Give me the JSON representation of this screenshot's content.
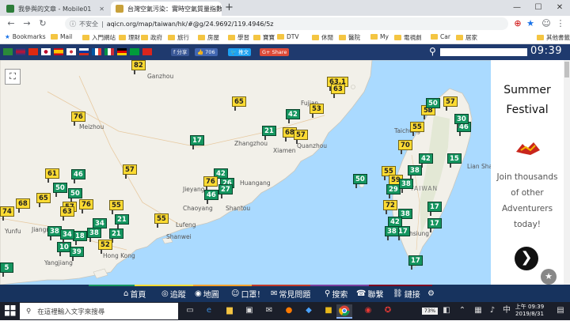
{
  "browser": {
    "tabs": [
      {
        "title": "我參與的文章 - Mobile01",
        "active": false
      },
      {
        "title": "台灣空氣污染：實時空氣質量指數地圖",
        "active": true
      }
    ],
    "new_tab": "+",
    "window_controls": {
      "minimize": "—",
      "maximize": "☐",
      "close": "✕"
    },
    "security_label": "不安全",
    "url": "aqicn.org/map/taiwan/hk/#@g/24.9692/119.4946/5z",
    "bookmarks": [
      {
        "label": "Bookmarks",
        "kind": "star"
      },
      {
        "label": "Mail",
        "kind": "folder"
      },
      {
        "label": "入門網站",
        "kind": "folder"
      },
      {
        "label": "理財",
        "kind": "folder"
      },
      {
        "label": "政府",
        "kind": "folder"
      },
      {
        "label": "旅行",
        "kind": "folder"
      },
      {
        "label": "房屋",
        "kind": "folder"
      },
      {
        "label": "學習",
        "kind": "folder"
      },
      {
        "label": "寶寶",
        "kind": "folder"
      },
      {
        "label": "DTV",
        "kind": "folder"
      },
      {
        "label": "休閒",
        "kind": "folder"
      },
      {
        "label": "醫院",
        "kind": "folder"
      },
      {
        "label": "My",
        "kind": "folder"
      },
      {
        "label": "電視劇",
        "kind": "folder"
      },
      {
        "label": "Car",
        "kind": "folder"
      },
      {
        "label": "居家",
        "kind": "folder"
      },
      {
        "label": "其他書籤",
        "kind": "folder"
      }
    ]
  },
  "page_header": {
    "share_fb": "分享",
    "like": "706",
    "tweet": "推文",
    "gplus": "Share",
    "clock": "09:39"
  },
  "map": {
    "places": [
      {
        "name": "Ganzhou"
      },
      {
        "name": "Meizhou"
      },
      {
        "name": "Zhangzhou"
      },
      {
        "name": "Xiamen"
      },
      {
        "name": "Quanzhou"
      },
      {
        "name": "Huangang"
      },
      {
        "name": "Jieyang"
      },
      {
        "name": "Chaoyang"
      },
      {
        "name": "Shantou"
      },
      {
        "name": "Lufeng"
      },
      {
        "name": "Shanwei"
      },
      {
        "name": "Yunfu"
      },
      {
        "name": "Jiangmen"
      },
      {
        "name": "Hong Kong"
      },
      {
        "name": "Yangjiang"
      },
      {
        "name": "Taichung"
      },
      {
        "name": "Lian Shan"
      },
      {
        "name": "TAIWAN"
      },
      {
        "name": "Kaohsiung"
      },
      {
        "name": "Fujian"
      }
    ],
    "markers": [
      {
        "v": "82",
        "c": "y"
      },
      {
        "v": "76",
        "c": "y"
      },
      {
        "v": "65",
        "c": "y"
      },
      {
        "v": "42",
        "c": "g"
      },
      {
        "v": "53",
        "c": "y"
      },
      {
        "v": "63.1",
        "c": "y"
      },
      {
        "v": "63",
        "c": "y"
      },
      {
        "v": "21",
        "c": "g"
      },
      {
        "v": "68",
        "c": "y"
      },
      {
        "v": "57",
        "c": "y"
      },
      {
        "v": "17",
        "c": "g"
      },
      {
        "v": "57",
        "c": "y"
      },
      {
        "v": "61",
        "c": "y"
      },
      {
        "v": "46",
        "c": "g"
      },
      {
        "v": "42",
        "c": "g"
      },
      {
        "v": "76",
        "c": "y"
      },
      {
        "v": "26",
        "c": "g"
      },
      {
        "v": "27",
        "c": "g"
      },
      {
        "v": "46",
        "c": "g"
      },
      {
        "v": "50",
        "c": "g"
      },
      {
        "v": "50",
        "c": "g"
      },
      {
        "v": "65",
        "c": "y"
      },
      {
        "v": "68",
        "c": "y"
      },
      {
        "v": "57",
        "c": "y"
      },
      {
        "v": "76",
        "c": "y"
      },
      {
        "v": "63",
        "c": "y"
      },
      {
        "v": "74",
        "c": "y"
      },
      {
        "v": "55",
        "c": "y"
      },
      {
        "v": "55",
        "c": "y"
      },
      {
        "v": "34",
        "c": "g"
      },
      {
        "v": "21",
        "c": "g"
      },
      {
        "v": "21",
        "c": "g"
      },
      {
        "v": "38",
        "c": "g"
      },
      {
        "v": "18",
        "c": "g"
      },
      {
        "v": "52",
        "c": "y"
      },
      {
        "v": "10",
        "c": "g"
      },
      {
        "v": "39",
        "c": "g"
      },
      {
        "v": "34",
        "c": "g"
      },
      {
        "v": "38",
        "c": "g"
      },
      {
        "v": "57",
        "c": "y"
      },
      {
        "v": "53",
        "c": "y"
      },
      {
        "v": "50",
        "c": "g"
      },
      {
        "v": "46",
        "c": "g"
      },
      {
        "v": "55",
        "c": "y"
      },
      {
        "v": "70",
        "c": "y"
      },
      {
        "v": "42",
        "c": "g"
      },
      {
        "v": "55",
        "c": "y"
      },
      {
        "v": "59",
        "c": "y"
      },
      {
        "v": "38",
        "c": "g"
      },
      {
        "v": "15",
        "c": "g"
      },
      {
        "v": "72",
        "c": "y"
      },
      {
        "v": "38",
        "c": "g"
      },
      {
        "v": "17",
        "c": "g"
      },
      {
        "v": "17",
        "c": "g"
      },
      {
        "v": "42",
        "c": "g"
      },
      {
        "v": "17",
        "c": "g"
      },
      {
        "v": "50",
        "c": "g"
      },
      {
        "v": "38",
        "c": "g"
      },
      {
        "v": "29",
        "c": "g"
      },
      {
        "v": "30",
        "c": "g"
      },
      {
        "v": "38",
        "c": "g"
      },
      {
        "v": "17",
        "c": "g"
      },
      {
        "v": "5",
        "c": "g"
      }
    ]
  },
  "ad": {
    "line1": "Summer",
    "line2": "Festival",
    "body": [
      "Join thousands",
      "of other",
      "Adventurers",
      "today!"
    ],
    "next": "❯",
    "star": "★"
  },
  "site_nav": [
    {
      "icon": "⌂",
      "label": "首頁"
    },
    {
      "icon": "◎",
      "label": "追蹤"
    },
    {
      "icon": "◉",
      "label": "地圖"
    },
    {
      "icon": "☺",
      "label": "口罩！"
    },
    {
      "icon": "✉",
      "label": "常見問題"
    },
    {
      "icon": "⚲",
      "label": "搜索"
    },
    {
      "icon": "☎",
      "label": "聯繫"
    },
    {
      "icon": "⛓",
      "label": "鏈接"
    },
    {
      "icon": "⚙",
      "label": ""
    }
  ],
  "taskbar": {
    "search_placeholder": "在這裡輸入文字來搜尋",
    "battery": "73%",
    "time": "上午 09:39",
    "date": "2019/8/31"
  }
}
